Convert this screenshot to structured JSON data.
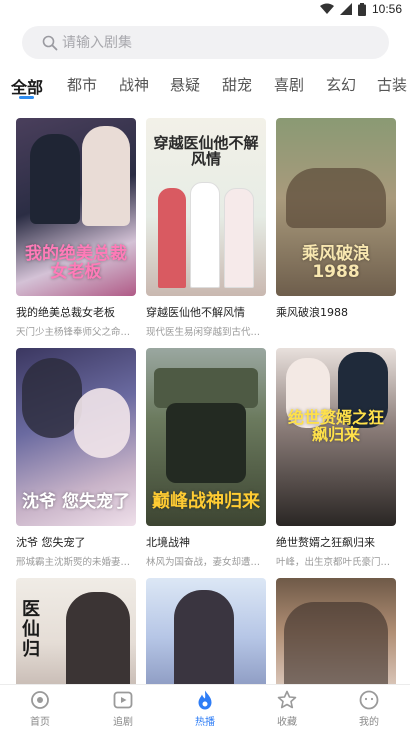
{
  "status_bar": {
    "time": "10:56"
  },
  "search": {
    "placeholder": "请输入剧集"
  },
  "tabs": [
    {
      "label": "全部",
      "active": true
    },
    {
      "label": "都市"
    },
    {
      "label": "战神"
    },
    {
      "label": "悬疑"
    },
    {
      "label": "甜宠"
    },
    {
      "label": "喜剧"
    },
    {
      "label": "玄幻"
    },
    {
      "label": "古装"
    }
  ],
  "dramas": [
    {
      "title": "我的绝美总裁女老板",
      "description": "天门少主杨锋奉师父之命…",
      "poster_text": "我的绝美总裁女老板"
    },
    {
      "title": "穿越医仙他不解风情",
      "description": "现代医生易闲穿越到古代…",
      "poster_text": "穿越医仙他不解风情"
    },
    {
      "title": "乘风破浪1988",
      "description": "",
      "poster_text": "乘风破浪1988"
    },
    {
      "title": "沈爷 您失宠了",
      "description": "邢城霸主沈斯煚的未婚妻…",
      "poster_text": "沈爷 您失宠了"
    },
    {
      "title": "北境战神",
      "description": "林风为国奋战，妻女却遭…",
      "poster_text": "巅峰战神归来"
    },
    {
      "title": "绝世赘婿之狂飙归来",
      "description": "叶峰，出生京都叶氏豪门…",
      "poster_text": "绝世赘婿之狂飙归来"
    },
    {
      "title": "",
      "description": "",
      "poster_text": "医仙归"
    },
    {
      "title": "",
      "description": "",
      "poster_text": ""
    },
    {
      "title": "",
      "description": "",
      "poster_text": ""
    }
  ],
  "bottom_nav": [
    {
      "label": "首页",
      "icon": "home-icon"
    },
    {
      "label": "追剧",
      "icon": "play-box-icon"
    },
    {
      "label": "热播",
      "icon": "flame-icon",
      "active": true
    },
    {
      "label": "收藏",
      "icon": "star-icon"
    },
    {
      "label": "我的",
      "icon": "profile-face-icon"
    }
  ],
  "colors": {
    "accent": "#2e7df6",
    "tab_indicator": "#2e8cf0"
  }
}
